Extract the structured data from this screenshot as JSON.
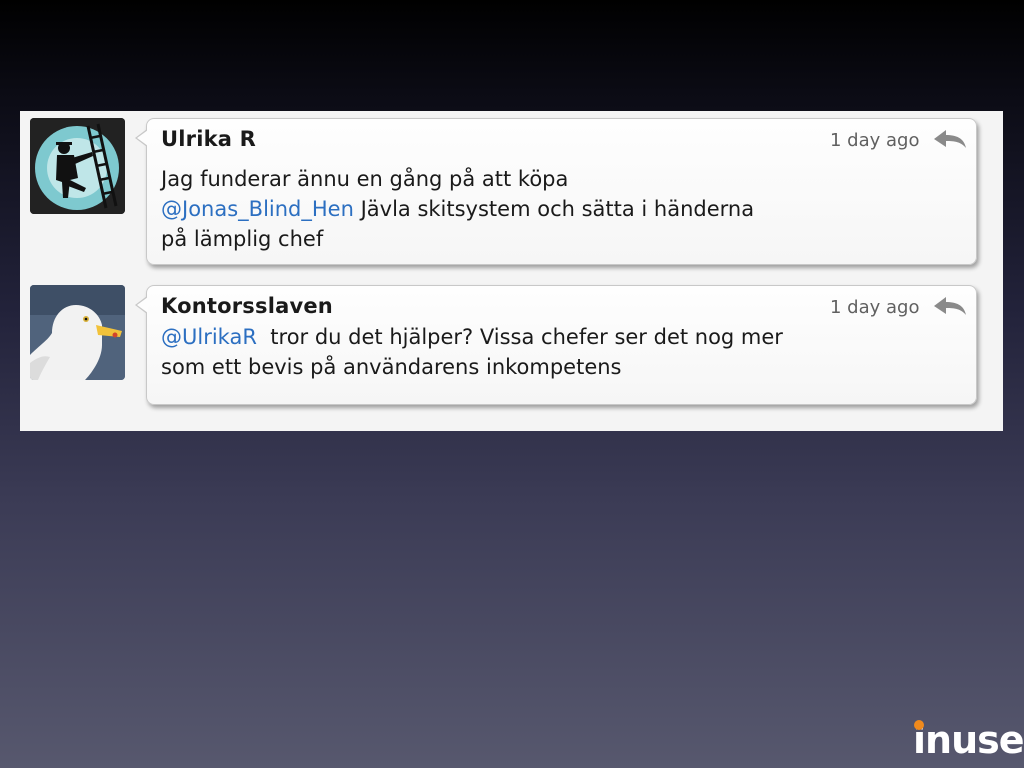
{
  "tweets": [
    {
      "author": "Ulrika R",
      "timestamp": "1 day ago",
      "avatar_icon": "window-cleaner-silhouette-avatar",
      "reply_icon": "reply-arrow-icon",
      "mention": "@Jonas_Blind_Hen",
      "line1": "Jag funderar ännu en gång på att köpa",
      "line2_rest": " Jävla skitsystem och sätta i händerna",
      "line3": "på lämplig chef"
    },
    {
      "author": "Kontorsslaven",
      "timestamp": "1 day ago",
      "avatar_icon": "seagull-avatar",
      "reply_icon": "reply-arrow-icon",
      "mention": "@UlrikaR",
      "line1_rest": "  tror du det hjälper? Vissa chefer ser det nog mer",
      "line2": "som ett bevis på användarens inkompetens"
    }
  ],
  "logo": {
    "text": "inuse",
    "accent_color": "#f08a1c"
  },
  "colors": {
    "mention": "#2c6fc1",
    "text": "#1a1a1a",
    "timestamp": "#606060"
  }
}
